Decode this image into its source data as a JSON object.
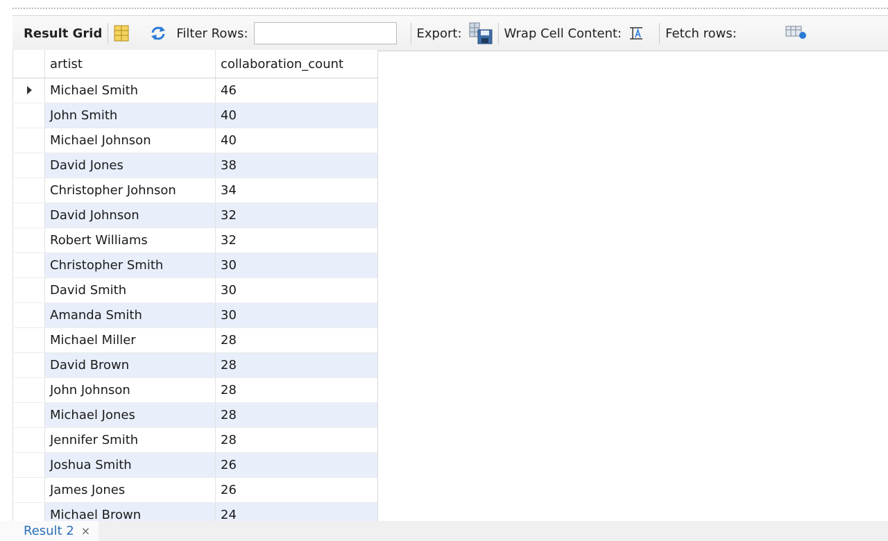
{
  "toolbar": {
    "result_grid_label": "Result Grid",
    "filter_rows_label": "Filter Rows:",
    "filter_rows_value": "",
    "export_label": "Export:",
    "wrap_cell_label": "Wrap Cell Content:",
    "fetch_rows_label": "Fetch rows:"
  },
  "grid": {
    "columns": [
      "artist",
      "collaboration_count"
    ],
    "rows": [
      {
        "artist": "Michael Smith",
        "count": "46"
      },
      {
        "artist": "John Smith",
        "count": "40"
      },
      {
        "artist": "Michael Johnson",
        "count": "40"
      },
      {
        "artist": "David Jones",
        "count": "38"
      },
      {
        "artist": "Christopher Johnson",
        "count": "34"
      },
      {
        "artist": "David Johnson",
        "count": "32"
      },
      {
        "artist": "Robert Williams",
        "count": "32"
      },
      {
        "artist": "Christopher Smith",
        "count": "30"
      },
      {
        "artist": "David Smith",
        "count": "30"
      },
      {
        "artist": "Amanda Smith",
        "count": "30"
      },
      {
        "artist": "Michael Miller",
        "count": "28"
      },
      {
        "artist": "David Brown",
        "count": "28"
      },
      {
        "artist": "John Johnson",
        "count": "28"
      },
      {
        "artist": "Michael Jones",
        "count": "28"
      },
      {
        "artist": "Jennifer Smith",
        "count": "28"
      },
      {
        "artist": "Joshua Smith",
        "count": "26"
      },
      {
        "artist": "James Jones",
        "count": "26"
      },
      {
        "artist": "Michael Brown",
        "count": "24"
      }
    ],
    "alt_row_color": "#e8eefa"
  },
  "tabs": {
    "result_tab_label": "Result 2",
    "close_glyph": "×"
  },
  "colors": {
    "tab_text": "#2a6fb8",
    "toolbar_bg": "#efefef"
  }
}
